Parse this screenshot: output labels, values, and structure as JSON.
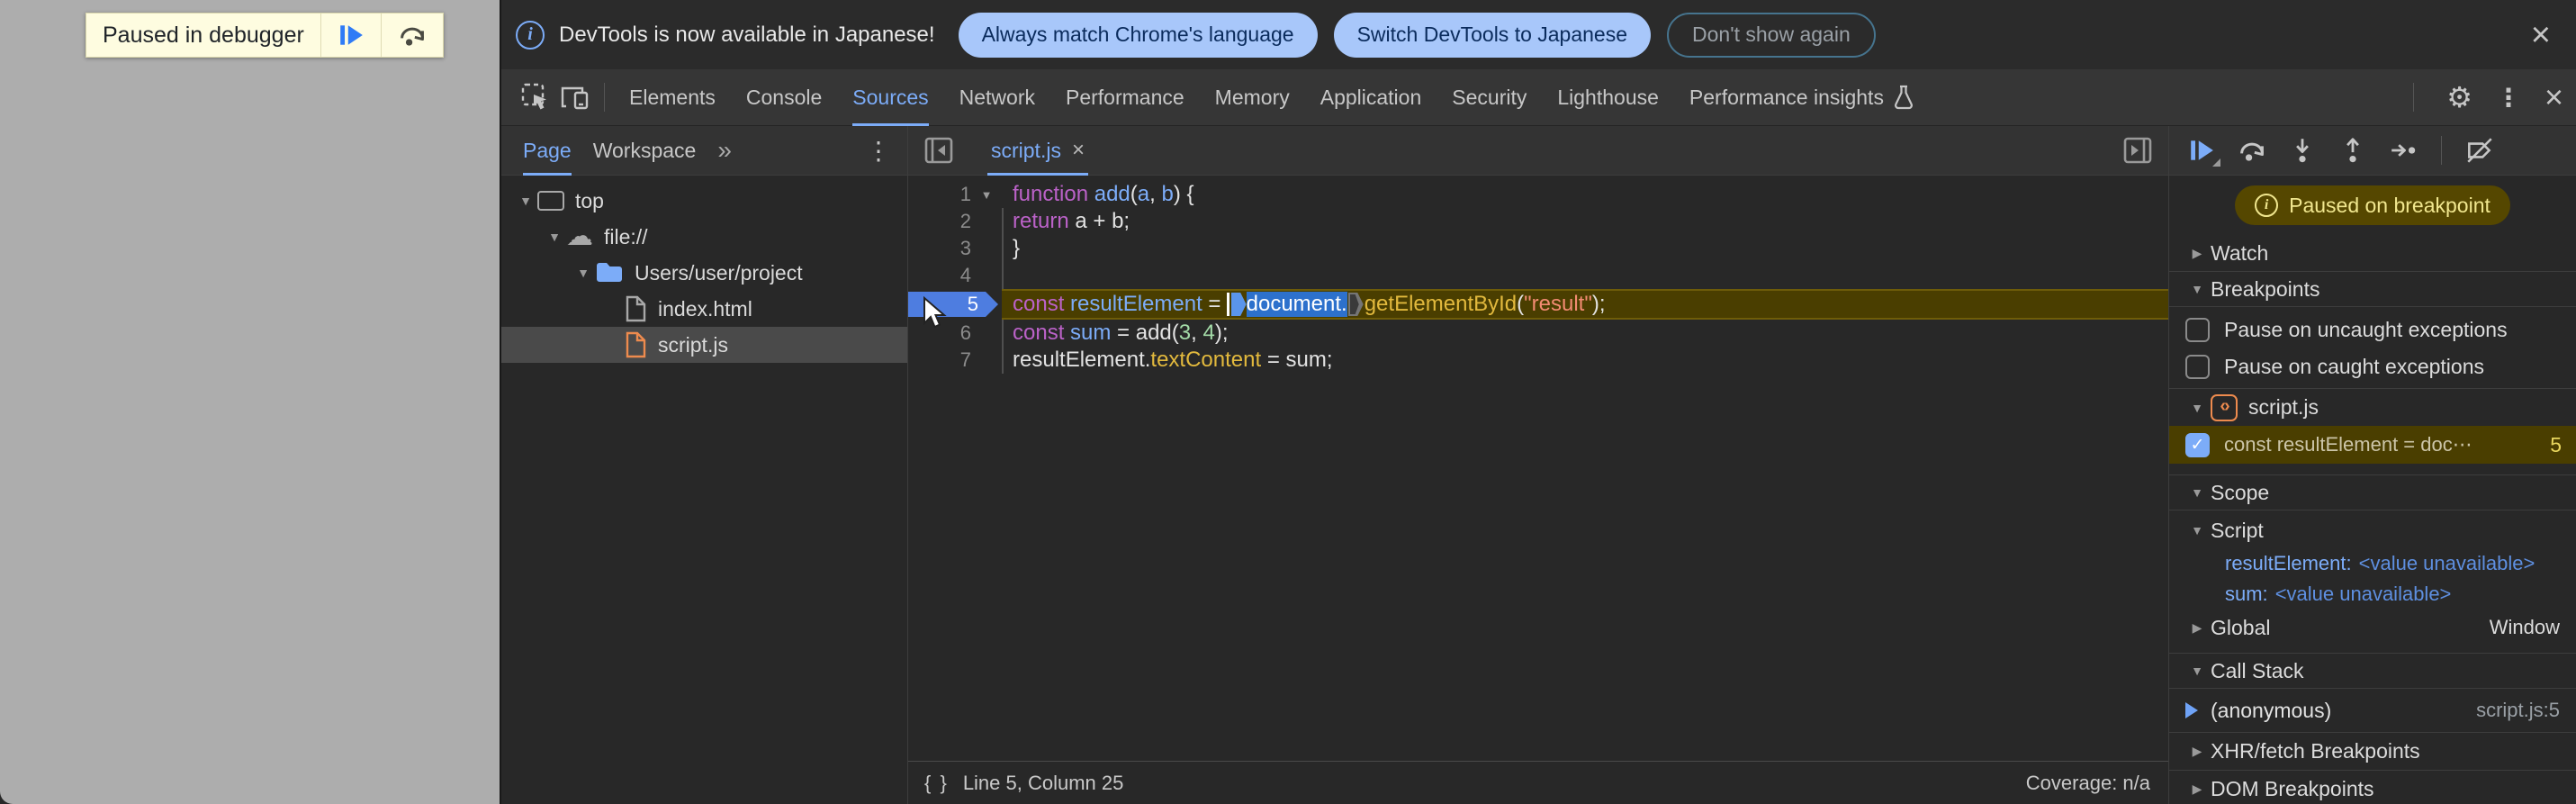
{
  "colors": {
    "accent_blue": "#7CACF8",
    "pill_blue": "#A8C7FA",
    "paused_pill_bg": "#554700",
    "execution_line_bg": "#4A3E00",
    "breakpoint_flag": "#4E7DE0",
    "orange_file": "#EE8B4E",
    "page_gray": "#ADADAD"
  },
  "icons": {
    "gear": "⚙",
    "kebab": "⋮",
    "close": "×",
    "chevron_double": "»",
    "triangle_down": "▼",
    "triangle_right": "▶",
    "check": "✓",
    "pretty_print": "{ }",
    "code_brackets": "‹›",
    "info": "i",
    "cloud": "☁"
  },
  "page": {
    "paused_banner_label": "Paused in debugger"
  },
  "notification": {
    "message": "DevTools is now available in Japanese!",
    "buttons": {
      "match": "Always match Chrome's language",
      "switch": "Switch DevTools to Japanese",
      "dismiss": "Don't show again"
    }
  },
  "main_tabs": {
    "selected": "Sources",
    "items": [
      {
        "label": "Elements"
      },
      {
        "label": "Console"
      },
      {
        "label": "Sources"
      },
      {
        "label": "Network"
      },
      {
        "label": "Performance"
      },
      {
        "label": "Memory"
      },
      {
        "label": "Application"
      },
      {
        "label": "Security"
      },
      {
        "label": "Lighthouse"
      },
      {
        "label": "Performance insights"
      }
    ]
  },
  "navigator": {
    "tabs": {
      "page": "Page",
      "workspace": "Workspace"
    },
    "tree": {
      "top": "top",
      "origin": "file://",
      "folder": "Users/user/project",
      "file_index": "index.html",
      "file_script": "script.js"
    }
  },
  "editor": {
    "open_tab": "script.js",
    "status_left": "Line 5, Column 25",
    "status_right": "Coverage: n/a",
    "lines": [
      {
        "num": "1",
        "tokens": [
          {
            "t": "function "
          },
          {
            "t": "add"
          },
          {
            "t": "("
          },
          {
            "t": "a"
          },
          {
            "t": ", "
          },
          {
            "t": "b"
          },
          {
            "t": ") {"
          }
        ]
      },
      {
        "num": "2",
        "tokens": [
          {
            "t": "return "
          },
          {
            "t": "a + b;"
          }
        ]
      },
      {
        "num": "3",
        "tokens": [
          {
            "t": "}"
          }
        ]
      },
      {
        "num": "4",
        "tokens": []
      },
      {
        "num": "5",
        "tokens": [
          {
            "t": "const "
          },
          {
            "t": "resultElement"
          },
          {
            "t": " = "
          },
          {
            "t": "document."
          },
          {
            "t": "getElementById"
          },
          {
            "t": "("
          },
          {
            "t": "\"result\""
          },
          {
            "t": ");"
          }
        ]
      },
      {
        "num": "6",
        "tokens": [
          {
            "t": "const "
          },
          {
            "t": "sum"
          },
          {
            "t": " = add("
          },
          {
            "t": "3"
          },
          {
            "t": ", "
          },
          {
            "t": "4"
          },
          {
            "t": ");"
          }
        ]
      },
      {
        "num": "7",
        "tokens": [
          {
            "t": "resultElement."
          },
          {
            "t": "textContent"
          },
          {
            "t": " = sum;"
          }
        ]
      }
    ]
  },
  "debugger": {
    "paused_message": "Paused on breakpoint",
    "watch": {
      "title": "Watch"
    },
    "breakpoints": {
      "title": "Breakpoints",
      "uncaught": "Pause on uncaught exceptions",
      "caught": "Pause on caught exceptions",
      "file": "script.js",
      "entry": {
        "label": "const resultElement = doc⋯",
        "line": "5"
      }
    },
    "scope": {
      "title": "Scope",
      "script_group": "Script",
      "vars": [
        {
          "name": "resultElement:",
          "value": "<value unavailable>"
        },
        {
          "name": "sum:",
          "value": "<value unavailable>"
        }
      ],
      "global_group": "Global",
      "global_value": "Window"
    },
    "call_stack": {
      "title": "Call Stack",
      "frames": [
        {
          "name": "(anonymous)",
          "location": "script.js:5"
        }
      ]
    },
    "xhr": {
      "title": "XHR/fetch Breakpoints"
    },
    "dom": {
      "title": "DOM Breakpoints"
    }
  }
}
